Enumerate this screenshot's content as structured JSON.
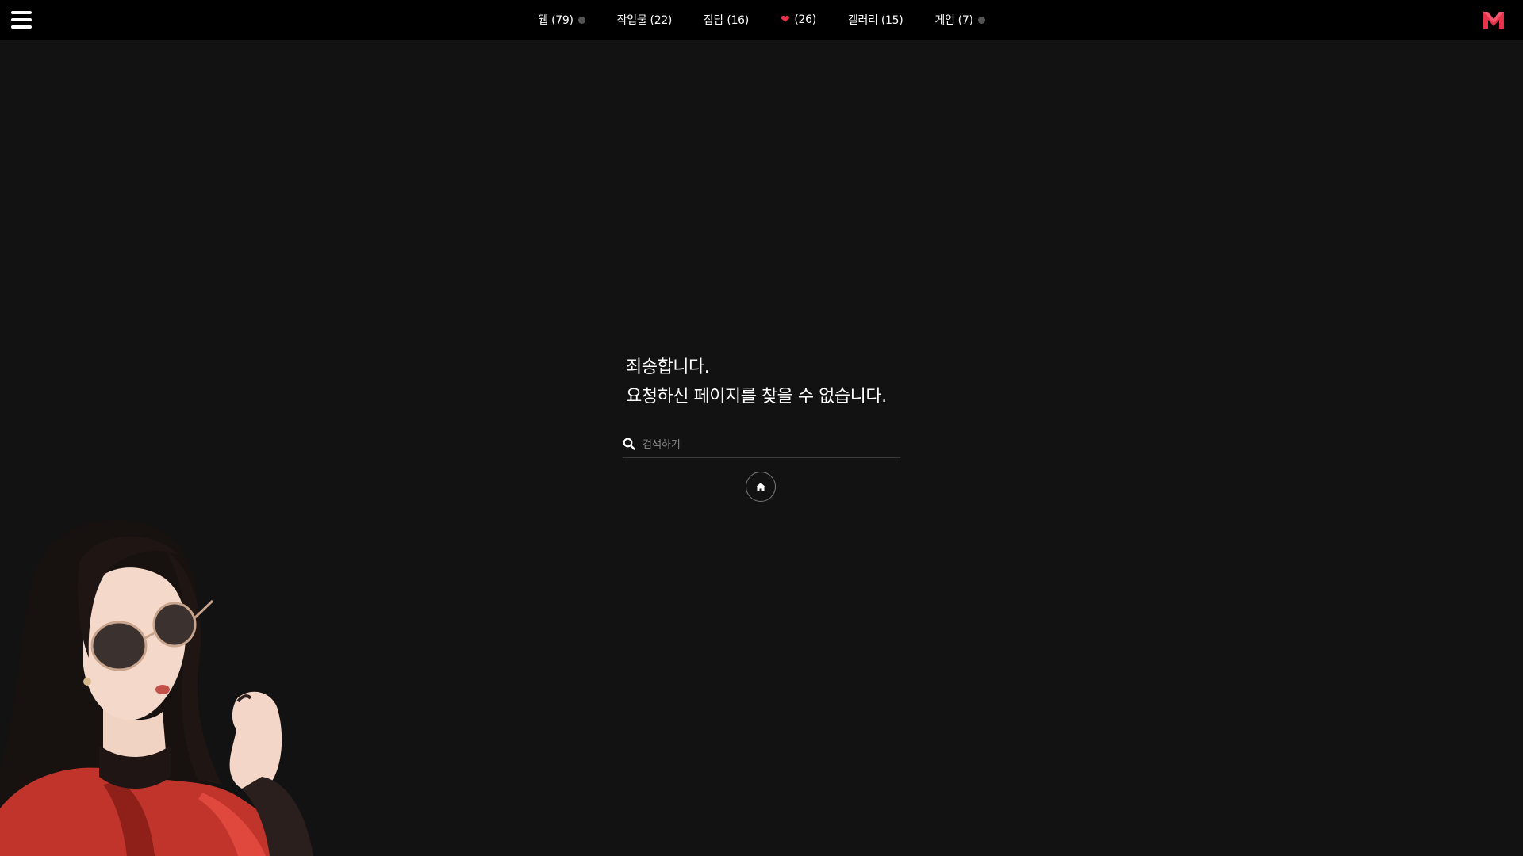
{
  "nav": {
    "items": [
      {
        "label": "웹 (79)",
        "dot": true,
        "dot_color": "#555555"
      },
      {
        "label": "작업물 (22)",
        "dot": false
      },
      {
        "label": "잡담 (16)",
        "dot": false
      },
      {
        "label": "(26)",
        "heart": true,
        "dot": false
      },
      {
        "label": "갤러리 (15)",
        "dot": false
      },
      {
        "label": "게임 (7)",
        "dot": true,
        "dot_color": "#555555"
      }
    ]
  },
  "logo": {
    "icon": "m-logo-icon",
    "color": "#e8324a"
  },
  "message": {
    "line1": "죄송합니다.",
    "line2": "요청하신 페이지를 찾을 수 없습니다."
  },
  "search": {
    "placeholder": "검색하기",
    "value": ""
  },
  "home_button": {
    "icon": "home-icon"
  },
  "colors": {
    "background": "#121212",
    "topbar": "#000000",
    "accent": "#e8324a"
  }
}
